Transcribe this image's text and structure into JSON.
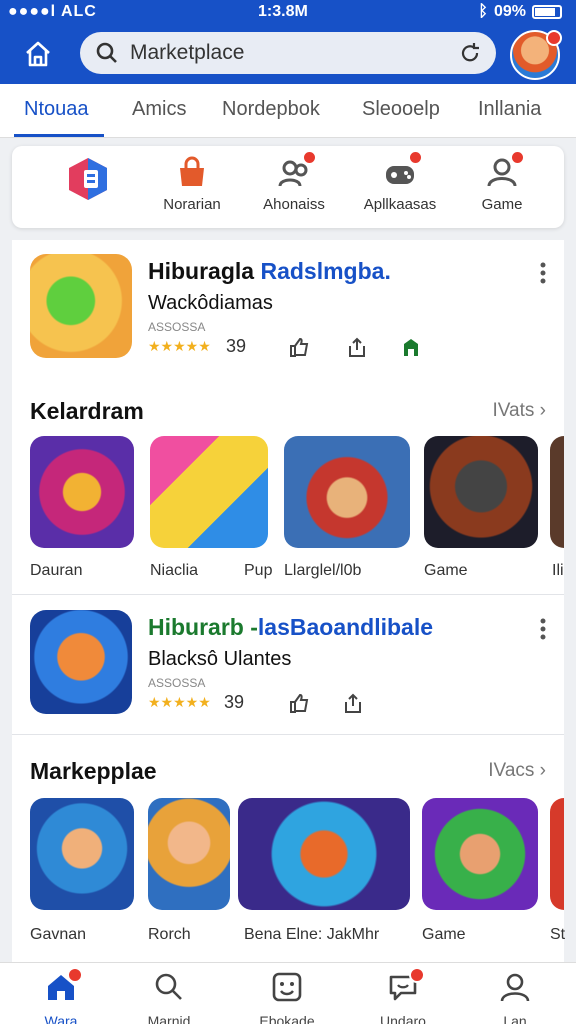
{
  "status_bar": {
    "carrier": "●●●●l ALC",
    "time": "1:3.8M",
    "battery": "09%"
  },
  "search": {
    "placeholder": "Marketplace"
  },
  "tabs": [
    {
      "label": "Ntouaa",
      "active": true
    },
    {
      "label": "Amics",
      "active": false
    },
    {
      "label": "Nordepbok",
      "active": false
    },
    {
      "label": "Sleooelp",
      "active": false
    },
    {
      "label": "Inllania",
      "active": false
    }
  ],
  "quick_links": [
    {
      "label": "",
      "icon": "app-logo-icon"
    },
    {
      "label": "Norarian",
      "icon": "tag-icon"
    },
    {
      "label": "Ahonaiss",
      "icon": "people-icon"
    },
    {
      "label": "Apllkaasas",
      "icon": "controller-icon"
    },
    {
      "label": "Game",
      "icon": "gamepad-icon"
    }
  ],
  "featured": [
    {
      "title_a": "Hiburagla",
      "title_b": "Radslmgba.",
      "subtitle": "Wackôdiamas",
      "meta": "ASSOSSA",
      "stars": "★★★★★",
      "rating": "39"
    },
    {
      "title_a": "Hiburarb -",
      "title_b": "lasBaoandlibale",
      "subtitle": "Blacksô Ulantes",
      "meta": "ASSOSSA",
      "stars": "★★★★★",
      "rating": "39"
    }
  ],
  "sections": [
    {
      "title": "Kelardram",
      "more": "IVats",
      "items": [
        {
          "label": "Dauran"
        },
        {
          "label": "Niaclia"
        },
        {
          "label": "Pup"
        },
        {
          "label": "Llarglel/l0b"
        },
        {
          "label": "Game"
        },
        {
          "label": "Ili"
        }
      ]
    },
    {
      "title": "Markepplae",
      "more": "IVacs",
      "items": [
        {
          "label": "Gavnan"
        },
        {
          "label": "Rorch"
        },
        {
          "label": "Bena Elne: JakMhr"
        },
        {
          "label": "Game"
        },
        {
          "label": "St"
        }
      ]
    }
  ],
  "bottom_nav": [
    {
      "label": "Wara",
      "active": true,
      "badge": true
    },
    {
      "label": "Marnid",
      "active": false,
      "badge": false
    },
    {
      "label": "Ebokade",
      "active": false,
      "badge": false
    },
    {
      "label": "Undaro",
      "active": false,
      "badge": true
    },
    {
      "label": "Lan",
      "active": false,
      "badge": false
    }
  ],
  "colors": {
    "brand_blue": "#1751c7",
    "badge_red": "#e8392d",
    "star_yellow": "#f2b01e"
  }
}
